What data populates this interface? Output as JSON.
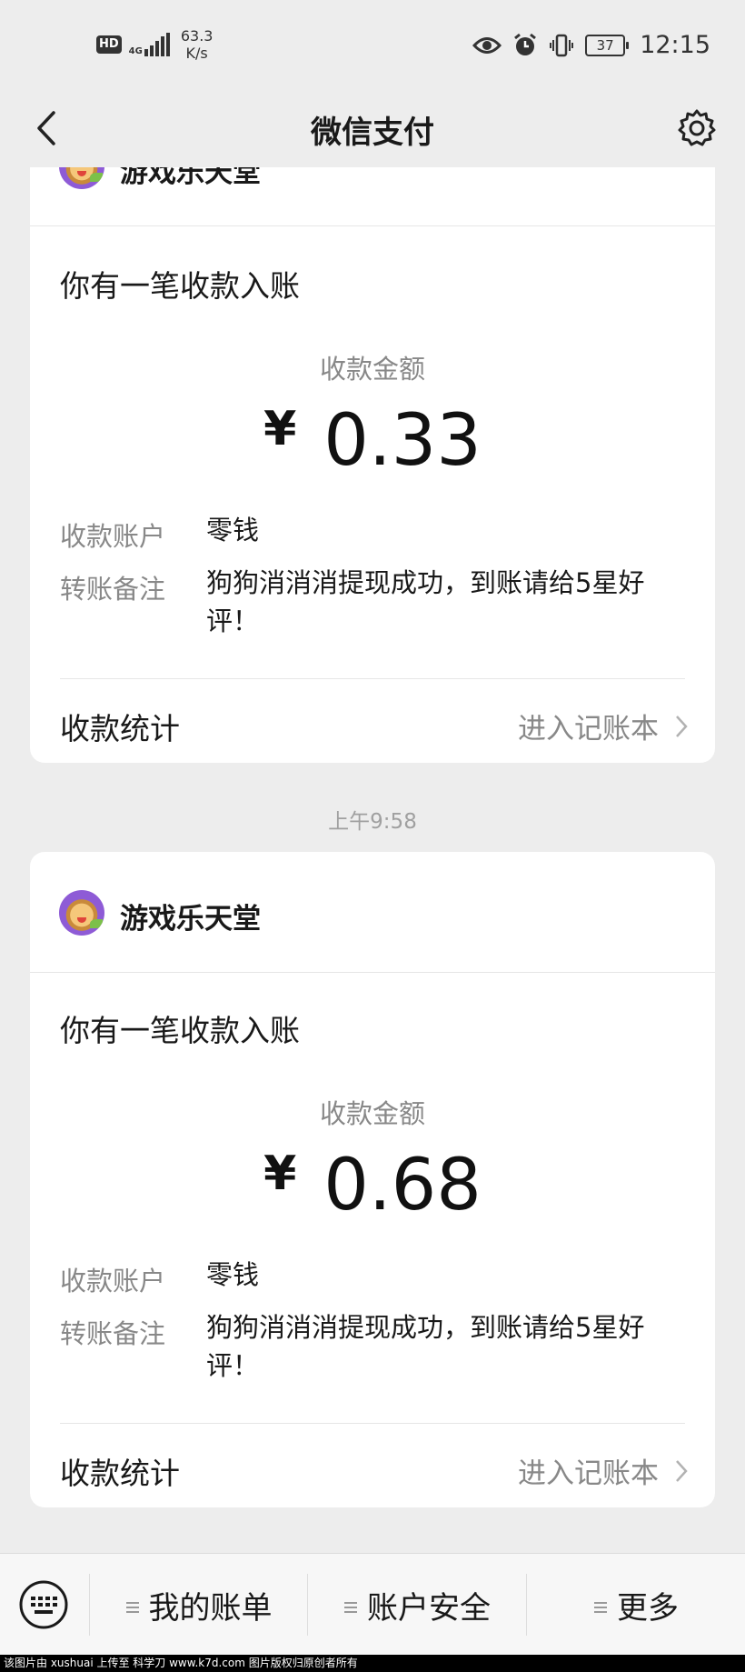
{
  "status_bar": {
    "hd": "HD",
    "network_type": "4G",
    "speed_value": "63.3",
    "speed_unit": "K/s",
    "battery": "37",
    "time": "12:15",
    "icons": [
      "eye-icon",
      "alarm-icon",
      "vibrate-icon",
      "battery-icon"
    ]
  },
  "nav": {
    "title": "微信支付",
    "back_icon": "chevron-left-icon",
    "settings_icon": "gear-icon"
  },
  "messages": [
    {
      "merchant": "游戏乐天堂",
      "title": "你有一笔收款入账",
      "amount_label": "收款金额",
      "currency": "¥",
      "amount": "0.33",
      "account_label": "收款账户",
      "account_value": "零钱",
      "remark_label": "转账备注",
      "remark_value": "狗狗消消消提现成功，到账请给5星好评！",
      "stat_label": "收款统计",
      "stat_link": "进入记账本"
    },
    {
      "timestamp": "上午9:58",
      "merchant": "游戏乐天堂",
      "title": "你有一笔收款入账",
      "amount_label": "收款金额",
      "currency": "¥",
      "amount": "0.68",
      "account_label": "收款账户",
      "account_value": "零钱",
      "remark_label": "转账备注",
      "remark_value": "狗狗消消消提现成功，到账请给5星好评！",
      "stat_label": "收款统计",
      "stat_link": "进入记账本"
    }
  ],
  "bottom_menu": {
    "keyboard_icon": "keyboard-icon",
    "items": [
      "我的账单",
      "账户安全",
      "更多"
    ]
  },
  "watermark": "该图片由 xushuai 上传至 科学刀 www.k7d.com 图片版权归原创者所有"
}
